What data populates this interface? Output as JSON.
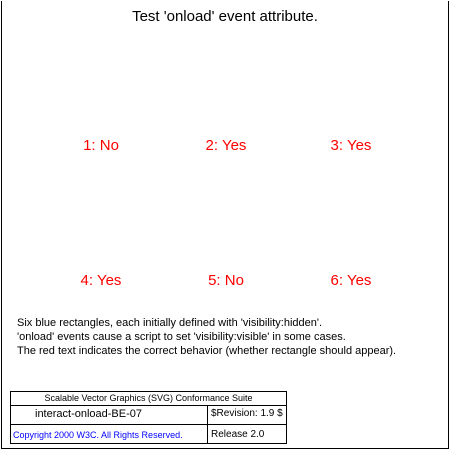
{
  "title": "Test 'onload' event attribute.",
  "results": [
    {
      "label": "1: No"
    },
    {
      "label": "2: Yes"
    },
    {
      "label": "3: Yes"
    },
    {
      "label": "4: Yes"
    },
    {
      "label": "5: No"
    },
    {
      "label": "6: Yes"
    }
  ],
  "description": {
    "line1": "Six blue rectangles, each initially defined with 'visibility:hidden'.",
    "line2": "'onload' events cause a script to set 'visibility:visible' in some cases.",
    "line3": "The red text indicates the correct behavior (whether rectangle should appear)."
  },
  "legend": {
    "suite": "Scalable Vector Graphics (SVG) Conformance Suite",
    "test_name": "interact-onload-BE-07",
    "revision": "$Revision: 1.9 $",
    "copyright": "Copyright 2000 W3C. All Rights Reserved.",
    "release": "Release 2.0"
  },
  "colors": {
    "result_text": "#ff0000",
    "copyright_text": "#0000ff",
    "frame": "#000000"
  }
}
